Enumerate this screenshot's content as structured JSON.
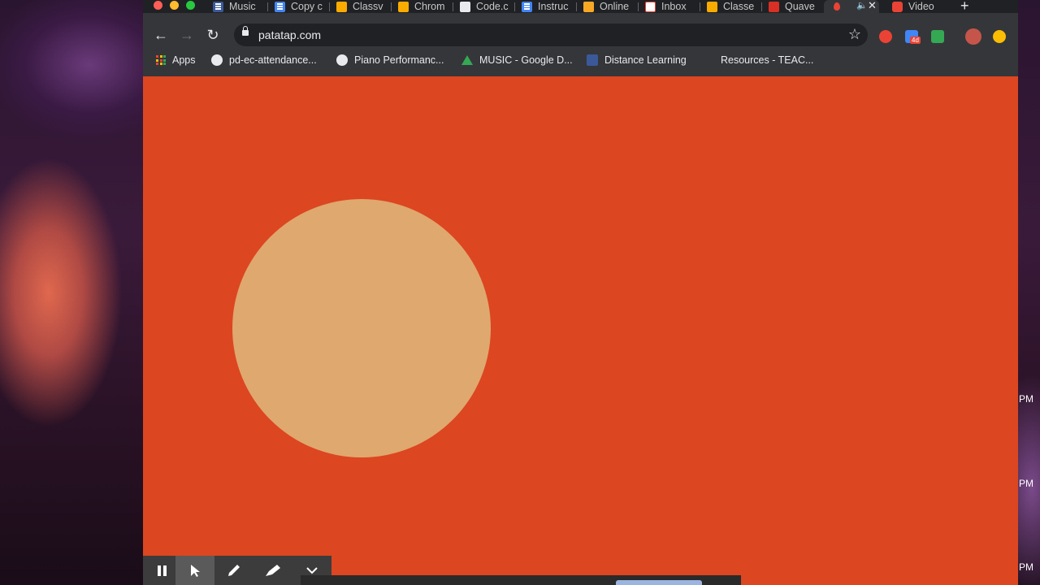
{
  "desktop": {
    "clock_labels": [
      "PM",
      "PM",
      "PM"
    ]
  },
  "browser": {
    "tabs": [
      {
        "label": "Music",
        "icon": "sites-icon",
        "color": "#3b5998"
      },
      {
        "label": "Copy c",
        "icon": "docs-icon",
        "color": "#4285f4"
      },
      {
        "label": "Classv",
        "icon": "classroom-icon",
        "color": "#f9ab00"
      },
      {
        "label": "Chrom",
        "icon": "chrome-music-lab-icon",
        "color": "#f9ab00"
      },
      {
        "label": "Code.c",
        "icon": "code-org-icon",
        "color": "#3c4043"
      },
      {
        "label": "Instruc",
        "icon": "docs-icon",
        "color": "#4285f4"
      },
      {
        "label": "Online",
        "icon": "online-icon",
        "color": "#f9a825"
      },
      {
        "label": "Inbox",
        "icon": "gmail-icon",
        "color": "#ea4335"
      },
      {
        "label": "Classe",
        "icon": "classroom-icon",
        "color": "#f9ab00"
      },
      {
        "label": "Quave",
        "icon": "quaver-icon",
        "color": "#d93025"
      },
      {
        "label": "",
        "icon": "active-tab-favicon-icon",
        "color": "#ea4335"
      },
      {
        "label": "Video",
        "icon": "video-icon",
        "color": "#ea4335"
      }
    ],
    "url": "patatap.com",
    "bookmarks": [
      {
        "label": "Apps",
        "icon": "apps-grid-icon"
      },
      {
        "label": "pd-ec-attendance...",
        "icon": "globe-icon"
      },
      {
        "label": "Piano Performanc...",
        "icon": "globe-icon"
      },
      {
        "label": "MUSIC - Google D...",
        "icon": "google-drive-icon"
      },
      {
        "label": "Distance Learning",
        "icon": "sites-icon"
      },
      {
        "label": "Resources - TEAC...",
        "icon": "blank-page-icon"
      }
    ],
    "extension_badge": "4d"
  },
  "page": {
    "background_color": "#dc4620",
    "circle_color": "#dfa86e"
  },
  "screencast": {
    "buttons": [
      "pause-icon",
      "pointer-icon",
      "pen-icon",
      "highlighter-icon",
      "chevron-down-icon"
    ]
  }
}
